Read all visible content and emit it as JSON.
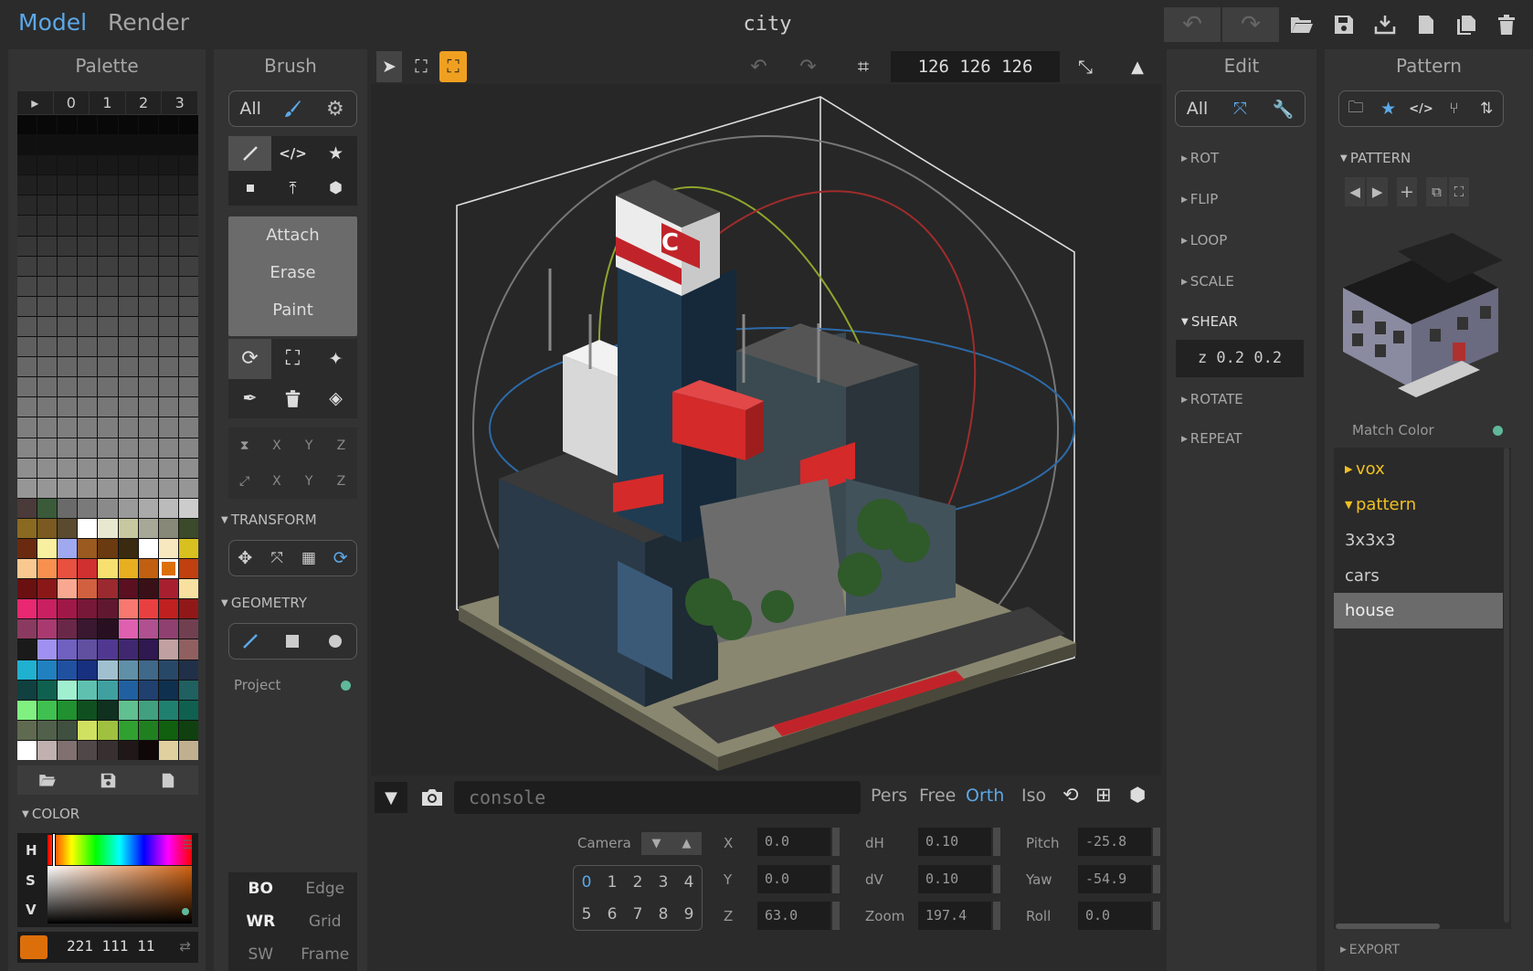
{
  "header": {
    "mode_model": "Model",
    "mode_render": "Render",
    "file_title": "city"
  },
  "palette": {
    "title": "Palette",
    "tabs": [
      "▸",
      "0",
      "1",
      "2",
      "3"
    ],
    "color_section": "COLOR",
    "hsv_labels": [
      "H",
      "S",
      "V"
    ],
    "current_rgb": "221 111 11",
    "current_hex": "#dd6f0b"
  },
  "brush": {
    "title": "Brush",
    "filter_all": "All",
    "modes": [
      "Attach",
      "Erase",
      "Paint"
    ],
    "mirror_axes": [
      "X",
      "Y",
      "Z",
      "X",
      "Y",
      "Z"
    ],
    "transform_section": "TRANSFORM",
    "geometry_section": "GEOMETRY",
    "project_label": "Project",
    "display": [
      {
        "label": "BO",
        "on": true
      },
      {
        "label": "Edge",
        "on": false
      },
      {
        "label": "WR",
        "on": true
      },
      {
        "label": "Grid",
        "on": false
      },
      {
        "label": "SW",
        "on": false
      },
      {
        "label": "Frame",
        "on": false
      }
    ]
  },
  "viewport": {
    "size": "126 126 126"
  },
  "console": {
    "placeholder": "console",
    "projections": [
      "Pers",
      "Free",
      "Orth",
      "Iso"
    ],
    "active_projection": "Orth",
    "camera_label": "Camera",
    "camera_slots": [
      "0",
      "1",
      "2",
      "3",
      "4",
      "5",
      "6",
      "7",
      "8",
      "9"
    ],
    "fields": [
      {
        "label": "X",
        "value": "0.0"
      },
      {
        "label": "Y",
        "value": "0.0"
      },
      {
        "label": "Z",
        "value": "63.0"
      },
      {
        "label": "dH",
        "value": "0.10"
      },
      {
        "label": "dV",
        "value": "0.10"
      },
      {
        "label": "Zoom",
        "value": "197.4"
      },
      {
        "label": "Pitch",
        "value": "-25.8"
      },
      {
        "label": "Yaw",
        "value": "-54.9"
      },
      {
        "label": "Roll",
        "value": "0.0"
      }
    ]
  },
  "edit": {
    "title": "Edit",
    "filter_all": "All",
    "items": [
      "ROT",
      "FLIP",
      "LOOP",
      "SCALE",
      "SHEAR",
      "ROTATE",
      "REPEAT"
    ],
    "shear_value": "z 0.2 0.2"
  },
  "pattern": {
    "title": "Pattern",
    "section": "PATTERN",
    "match_color": "Match Color",
    "tree": [
      {
        "label": "vox",
        "type": "folder"
      },
      {
        "label": "pattern",
        "type": "folder-open"
      },
      {
        "label": "3x3x3",
        "type": "file"
      },
      {
        "label": "cars",
        "type": "file"
      },
      {
        "label": "house",
        "type": "file-selected"
      }
    ],
    "export": "EXPORT"
  },
  "colors": {
    "accent_blue": "#5ca8e8",
    "folder_yellow": "#f0c020",
    "status_green": "#5fb89a"
  }
}
